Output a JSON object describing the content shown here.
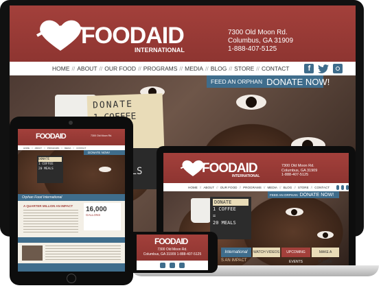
{
  "brand": {
    "name": "FOODAID",
    "sub": "INTERNATIONAL"
  },
  "address": {
    "line1": "7300 Old Moon Rd.",
    "line2": "Columbus, GA 31909",
    "phone": "1-888-407-5125"
  },
  "nav": [
    "HOME",
    "ABOUT",
    "OUR FOOD",
    "PROGRAMS",
    "MEDIA",
    "BLOG",
    "STORE",
    "CONTACT"
  ],
  "nav_sep": "//",
  "social": [
    "facebook-icon",
    "twitter-icon",
    "instagram-icon"
  ],
  "donate": {
    "feed": "FEED AN ORPHAN",
    "cta": "DONATE NOW!"
  },
  "hero": {
    "sign1": "DONATE",
    "sign2": "1 COFFEE",
    "sign3": "=",
    "sign4": "20 MEALS"
  },
  "tablet": {
    "hero_caption": "Orphan Food International",
    "impact_title": "A QUARTER MILLION AN IMPACT",
    "stat": "16,000",
    "stat_label": "GALLONS"
  },
  "laptop": {
    "tab1": "International",
    "tab2": "WATCH VIDEOS",
    "tab3": "UPCOMING EVENTS",
    "tab4": "MAKE A PLEDGE",
    "impact": "S AN IMPACT"
  },
  "phone": {
    "address": "7300 Old Moon Rd.",
    "line2": "Columbus, GA 31909 1-888-407-5125"
  }
}
